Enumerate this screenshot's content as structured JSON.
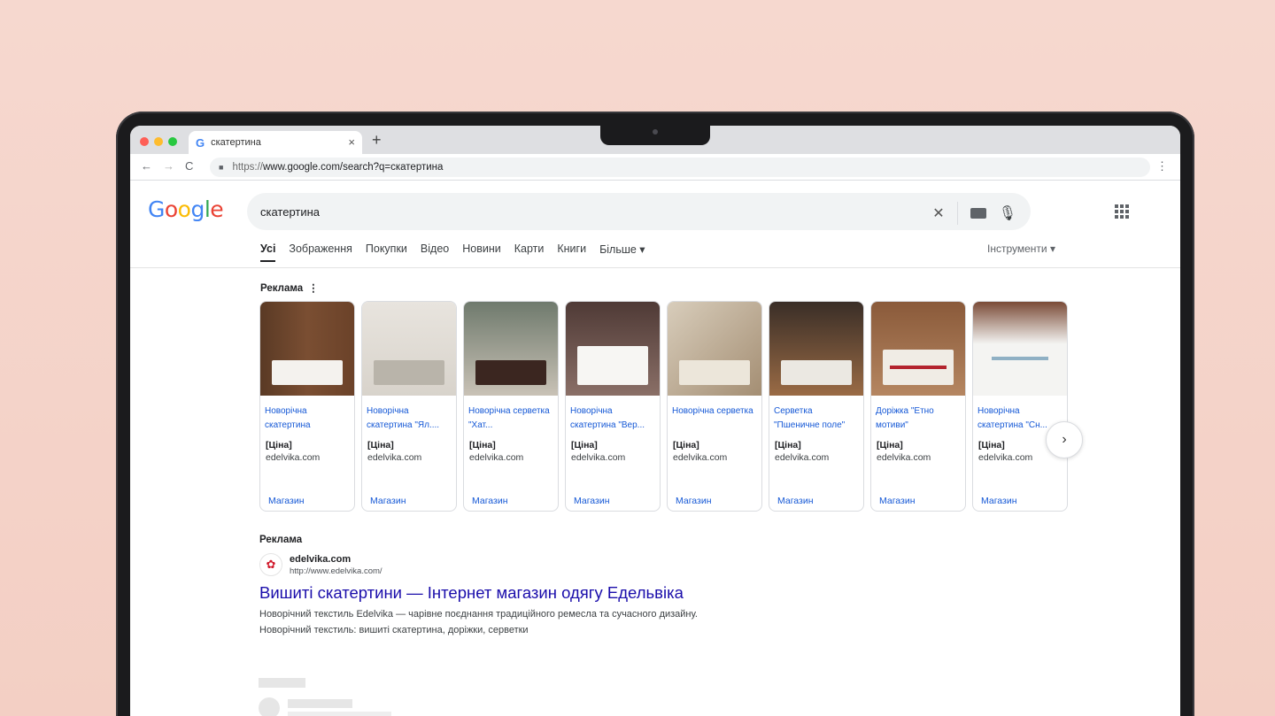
{
  "browser": {
    "tab_title": "скатертина",
    "tab_favicon": "G",
    "new_tab": "+",
    "close_tab": "×",
    "url_proto": "https://",
    "url_rest": "www.google.com/search?q=скатертина",
    "back": "←",
    "forward": "→",
    "reload": "C",
    "menu": "⋮"
  },
  "google": {
    "logo": [
      "G",
      "o",
      "o",
      "g",
      "l",
      "e"
    ],
    "query": "скатертина",
    "clear": "✕",
    "tabs": [
      "Усі",
      "Зображення",
      "Покупки",
      "Відео",
      "Новини",
      "Карти",
      "Книги",
      "Більше ▾"
    ],
    "tools": "Інструменти ▾"
  },
  "ads_shopping": {
    "label": "Реклама",
    "dots": "⋮",
    "next": "›",
    "cards": [
      {
        "title": "Новорічна скатертина",
        "price": "[Ціна]",
        "domain": "edelvika.com",
        "shop": "Магазин"
      },
      {
        "title": "Новорічна скатертина \"Ял....",
        "price": "[Ціна]",
        "domain": "edelvika.com",
        "shop": "Магазин"
      },
      {
        "title": "Новорічна серветка \"Хат...",
        "price": "[Ціна]",
        "domain": "edelvika.com",
        "shop": "Магазин"
      },
      {
        "title": "Новорічна скатертина \"Вер...",
        "price": "[Ціна]",
        "domain": "edelvika.com",
        "shop": "Магазин"
      },
      {
        "title": "Новорічна серветка",
        "price": "[Ціна]",
        "domain": "edelvika.com",
        "shop": "Магазин"
      },
      {
        "title": "Серветка \"Пшеничне поле\"",
        "price": "[Ціна]",
        "domain": "edelvika.com",
        "shop": "Магазин"
      },
      {
        "title": "Доріжка \"Етно мотиви\"",
        "price": "[Ціна]",
        "domain": "edelvika.com",
        "shop": "Магазин"
      },
      {
        "title": "Новорічна скатертина \"Сн...",
        "price": "[Ціна]",
        "domain": "edelvika.com",
        "shop": "Магазин"
      }
    ]
  },
  "text_ad": {
    "label": "Реклама",
    "domain": "edelvika.com",
    "url": "http://www.edelvika.com/",
    "headline": "Вишиті скатертини — Інтернет магазин одягу Едельвіка",
    "description": "Новорічний текстиль Edelvika — чарівне поєднання традиційного ремесла та сучасного дизайну. Новорічний текстиль: вишиті скатертина, доріжки, серветки"
  },
  "colors": {
    "accent_link": "#1a0dab",
    "shop_link": "#1558d6",
    "google_blue": "#4285f4",
    "google_red": "#ea4335",
    "google_yellow": "#fbbc05",
    "google_green": "#34a853"
  }
}
